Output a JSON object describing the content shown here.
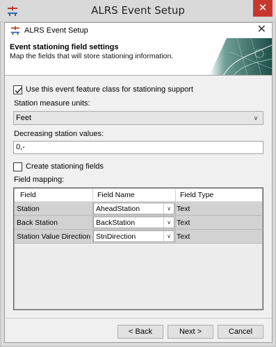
{
  "window": {
    "title": "ALRS Event Setup",
    "close_glyph": "✕",
    "app_icon": "alrs-app-icon"
  },
  "dialog": {
    "title": "ALRS Event Setup",
    "close_glyph": "✕",
    "icon": "alrs-app-icon"
  },
  "banner": {
    "heading": "Event stationing field settings",
    "subtitle": "Map the fields that will store stationing information."
  },
  "options": {
    "use_event_fc_label": "Use this event feature class for stationing support",
    "use_event_fc_checked": true,
    "measure_units_label": "Station measure units:",
    "measure_units_value": "Feet",
    "decreasing_label": "Decreasing station values:",
    "decreasing_value": "0,-",
    "create_fields_label": "Create stationing fields",
    "create_fields_checked": false,
    "field_mapping_label": "Field mapping:"
  },
  "grid": {
    "columns": [
      "Field",
      "Field Name",
      "Field Type"
    ],
    "rows": [
      {
        "field": "Station",
        "field_name": "AheadStation",
        "field_type": "Text"
      },
      {
        "field": "Back Station",
        "field_name": "BackStation",
        "field_type": "Text"
      },
      {
        "field": "Station Value Direction",
        "field_name": "StnDirection",
        "field_type": "Text"
      }
    ]
  },
  "buttons": {
    "back": "< Back",
    "next": "Next >",
    "cancel": "Cancel"
  },
  "colors": {
    "outer_close": "#c8372d",
    "banner_graphic": "#2e6f68"
  }
}
